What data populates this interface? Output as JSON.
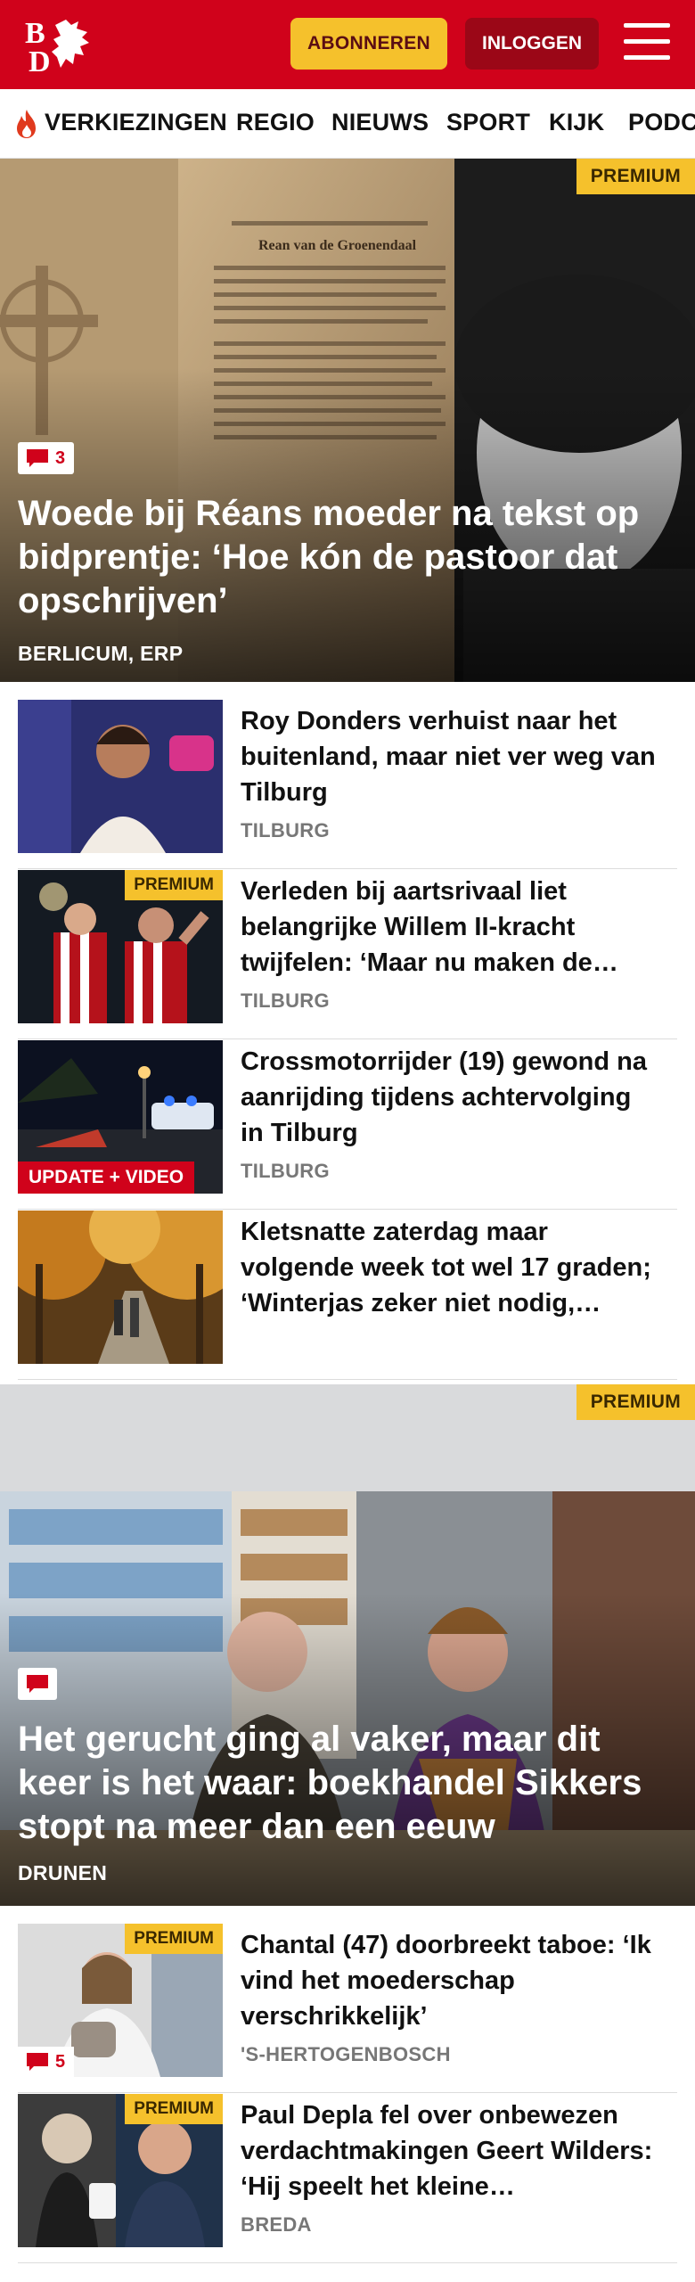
{
  "header": {
    "logo_text": "BD",
    "subscribe_label": "ABONNEREN",
    "login_label": "INLOGGEN",
    "brand_color": "#d0021b",
    "accent_color": "#f5c12c"
  },
  "nav": {
    "items": [
      "VERKIEZINGEN",
      "REGIO",
      "NIEUWS",
      "SPORT",
      "KIJK",
      "PODC"
    ]
  },
  "hero1": {
    "badge": "PREMIUM",
    "comments": "3",
    "title": "Woede bij Réans moeder na tekst op bidprentje: ‘Hoe kón de pastoor dat opschrijven’",
    "location": "BERLICUM, ERP",
    "card_name": "Rean van de Groenendaal"
  },
  "list1": [
    {
      "title": "Roy Donders verhuist naar het buitenland, maar niet ver weg van Tilburg",
      "location": "TILBURG",
      "badge": "",
      "label": ""
    },
    {
      "title": "Verleden bij aartsrivaal liet belangrijke Willem II-kracht twijfelen: ‘Maar nu maken de…",
      "location": "TILBURG",
      "badge": "PREMIUM",
      "label": ""
    },
    {
      "title": "Crossmotorrijder (19) gewond na aanrijding tijdens achtervolging in Tilburg",
      "location": "TILBURG",
      "badge": "",
      "label": "UPDATE + VIDEO"
    },
    {
      "title": "Kletsnatte zaterdag maar volgende week tot wel 17 graden; ‘Winterjas zeker niet nodig,…",
      "location": "",
      "badge": "",
      "label": ""
    }
  ],
  "hero2": {
    "badge": "PREMIUM",
    "title": "Het gerucht ging al vaker, maar dit keer is het waar: boekhandel Sikkers stopt na meer dan een eeuw",
    "location": "DRUNEN"
  },
  "list2": [
    {
      "title": "Chantal (47) doorbreekt taboe: ‘Ik vind het moederschap verschrikkelijk’",
      "location": "'S-HERTOGENBOSCH",
      "badge": "PREMIUM",
      "comments": "5"
    },
    {
      "title": "Paul Depla fel over onbewezen verdachtmakingen Geert Wilders: ‘Hij speelt het kleine…",
      "location": "BREDA",
      "badge": "PREMIUM",
      "comments": ""
    }
  ]
}
